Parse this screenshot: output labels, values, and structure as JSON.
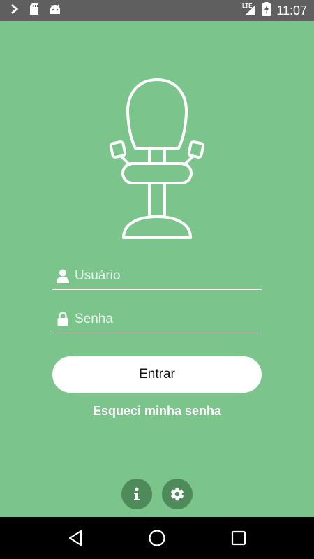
{
  "status_bar": {
    "time": "11:07",
    "network": "LTE",
    "icons": [
      "chevron-right-icon",
      "sd-card-icon",
      "android-icon",
      "signal-icon",
      "battery-charging-icon"
    ]
  },
  "login": {
    "logo": "office-chair-icon",
    "username_placeholder": "Usuário",
    "password_placeholder": "Senha",
    "enter_label": "Entrar",
    "forgot_label": "Esqueci minha senha"
  },
  "footer": {
    "info_icon": "info-icon",
    "settings_icon": "gear-icon"
  },
  "nav": {
    "icons": [
      "back-icon",
      "home-icon",
      "recents-icon"
    ]
  },
  "colors": {
    "background": "#7bc58c",
    "round_button": "#4f8a5b",
    "status_bar": "#5f5f5f",
    "nav_bar": "#000000"
  }
}
